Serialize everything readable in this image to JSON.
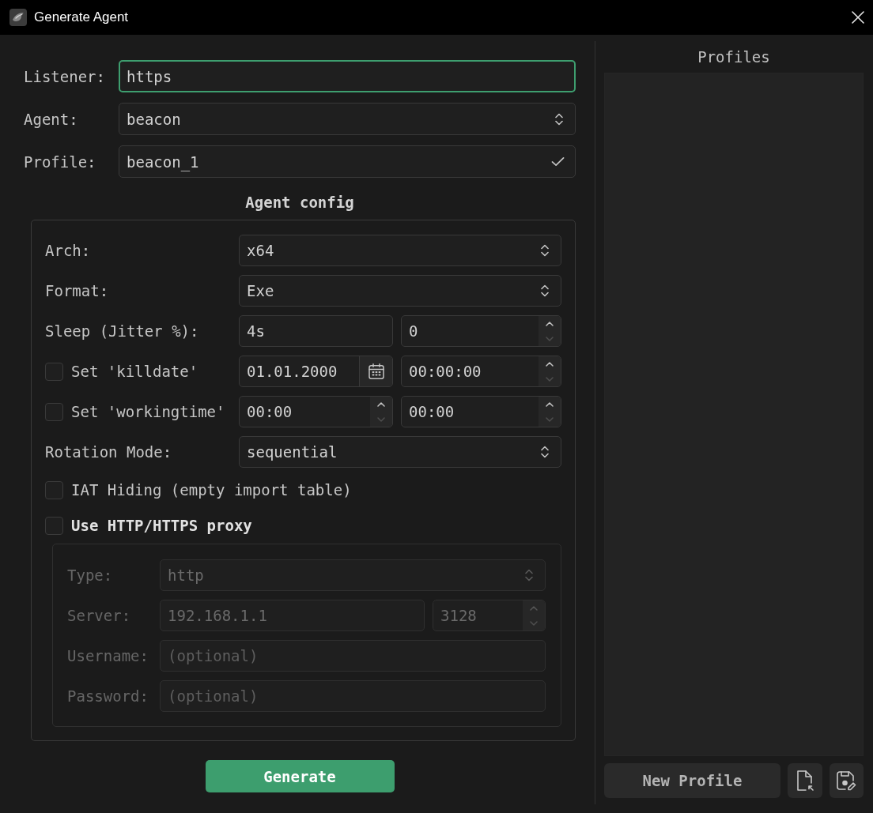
{
  "window": {
    "title": "Generate Agent"
  },
  "top_fields": [
    {
      "label": "Listener:",
      "kind": "text",
      "value": "https",
      "focused": true
    },
    {
      "label": "Agent:",
      "kind": "select",
      "value": "beacon",
      "focused": false
    },
    {
      "label": "Profile:",
      "kind": "confirm",
      "value": "beacon_1",
      "focused": false
    }
  ],
  "agent_config": {
    "title": "Agent config",
    "rows": [
      {
        "kind": "fields",
        "label": "Arch:",
        "fields": [
          {
            "kind": "select",
            "value": "x64"
          }
        ]
      },
      {
        "kind": "fields",
        "label": "Format:",
        "fields": [
          {
            "kind": "select",
            "value": "Exe"
          }
        ]
      },
      {
        "kind": "fields",
        "label": "Sleep (Jitter %):",
        "fields": [
          {
            "kind": "text",
            "value": "4s"
          },
          {
            "kind": "spin",
            "value": "0"
          }
        ]
      },
      {
        "kind": "fields",
        "label": "Set 'killdate'",
        "checkbox": {
          "checked": false
        },
        "fields": [
          {
            "kind": "date",
            "value": "01.01.2000"
          },
          {
            "kind": "spin",
            "value": "00:00:00"
          }
        ]
      },
      {
        "kind": "fields",
        "label": "Set 'workingtime'",
        "checkbox": {
          "checked": false
        },
        "fields": [
          {
            "kind": "spin",
            "value": "00:00"
          },
          {
            "kind": "spin",
            "value": "00:00"
          }
        ]
      },
      {
        "kind": "fields",
        "label": "Rotation Mode:",
        "fields": [
          {
            "kind": "select",
            "value": "sequential"
          }
        ]
      },
      {
        "kind": "checkbox",
        "label": "IAT Hiding (empty import table)",
        "checked": false
      }
    ],
    "proxy": {
      "label": "Use HTTP/HTTPS proxy",
      "checked": false,
      "disabled": true,
      "rows": [
        {
          "label": "Type:",
          "fields": [
            {
              "kind": "select",
              "value": "http"
            }
          ]
        },
        {
          "label": "Server:",
          "fields": [
            {
              "kind": "text",
              "value": "192.168.1.1"
            },
            {
              "kind": "spin",
              "value": "3128"
            }
          ]
        },
        {
          "label": "Username:",
          "fields": [
            {
              "kind": "text",
              "placeholder": "(optional)"
            }
          ]
        },
        {
          "label": "Password:",
          "fields": [
            {
              "kind": "text",
              "placeholder": "(optional)"
            }
          ]
        }
      ]
    }
  },
  "generate_button": {
    "label": "Generate"
  },
  "profiles": {
    "title": "Profiles",
    "new_button": {
      "label": "New Profile"
    }
  }
}
